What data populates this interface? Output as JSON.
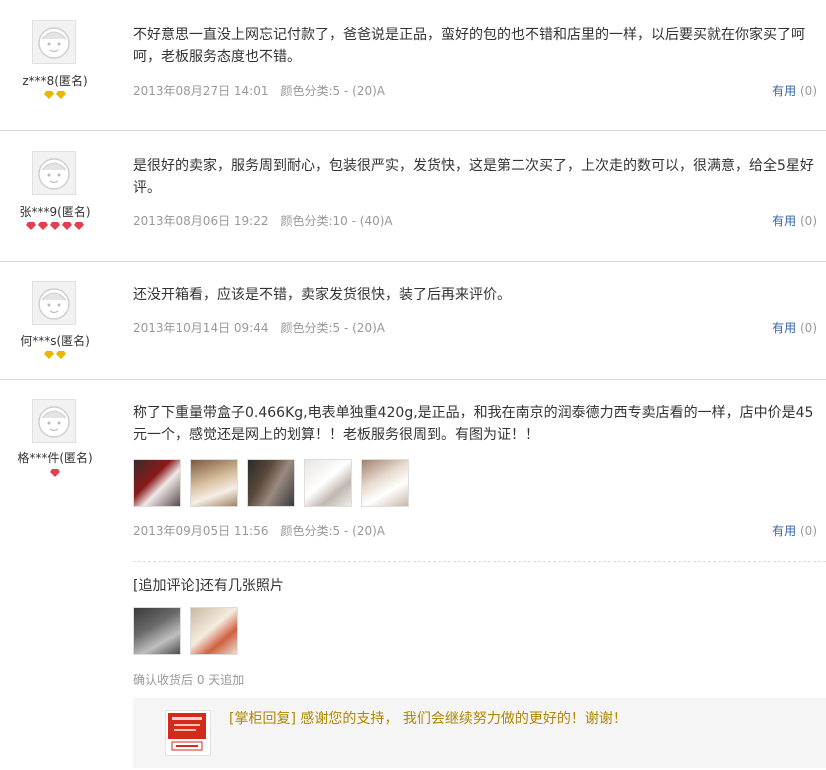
{
  "reviews": [
    {
      "user": "z***8(匿名)",
      "content": "不好意思一直没上网忘记付款了，爸爸说是正品，蛮好的包的也不错和店里的一样，以后要买就在你家买了呵呵，老板服务态度也不错。",
      "date": "2013年08月27日 14:01",
      "spec": "颜色分类:5 - (20)A",
      "useful_label": "有用",
      "useful_count": "(0)"
    },
    {
      "user": "张***9(匿名)",
      "content": "是很好的卖家，服务周到耐心，包装很严实，发货快，这是第二次买了，上次走的数可以，很满意，给全5星好评。",
      "date": "2013年08月06日 19:22",
      "spec": "颜色分类:10 - (40)A",
      "useful_label": "有用",
      "useful_count": "(0)"
    },
    {
      "user": "何***s(匿名)",
      "content": "还没开箱看，应该是不错，卖家发货很快，装了后再来评价。",
      "date": "2013年10月14日 09:44",
      "spec": "颜色分类:5 - (20)A",
      "useful_label": "有用",
      "useful_count": "(0)"
    },
    {
      "user": "格***件(匿名)",
      "content": "称了下重量带盒子0.466Kg,电表单独重420g,是正品，和我在南京的润泰德力西专卖店看的一样，店中价是45元一个，感觉还是网上的划算！！老板服务很周到。有图为证！！",
      "date": "2013年09月05日 11:56",
      "spec": "颜色分类:5 - (20)A",
      "useful_label": "有用",
      "useful_count": "(0)",
      "append_title": "[追加评论]还有几张照片",
      "append_note": "确认收货后 0 天追加",
      "reply_text": "[掌柜回复] 感谢您的支持， 我们会继续努力做的更好的！谢谢！"
    }
  ],
  "colors": {
    "link": "#3366aa",
    "reply": "#b08800",
    "muted": "#999999",
    "gem_gold": "#e8b800",
    "gem_red": "#e04050"
  }
}
